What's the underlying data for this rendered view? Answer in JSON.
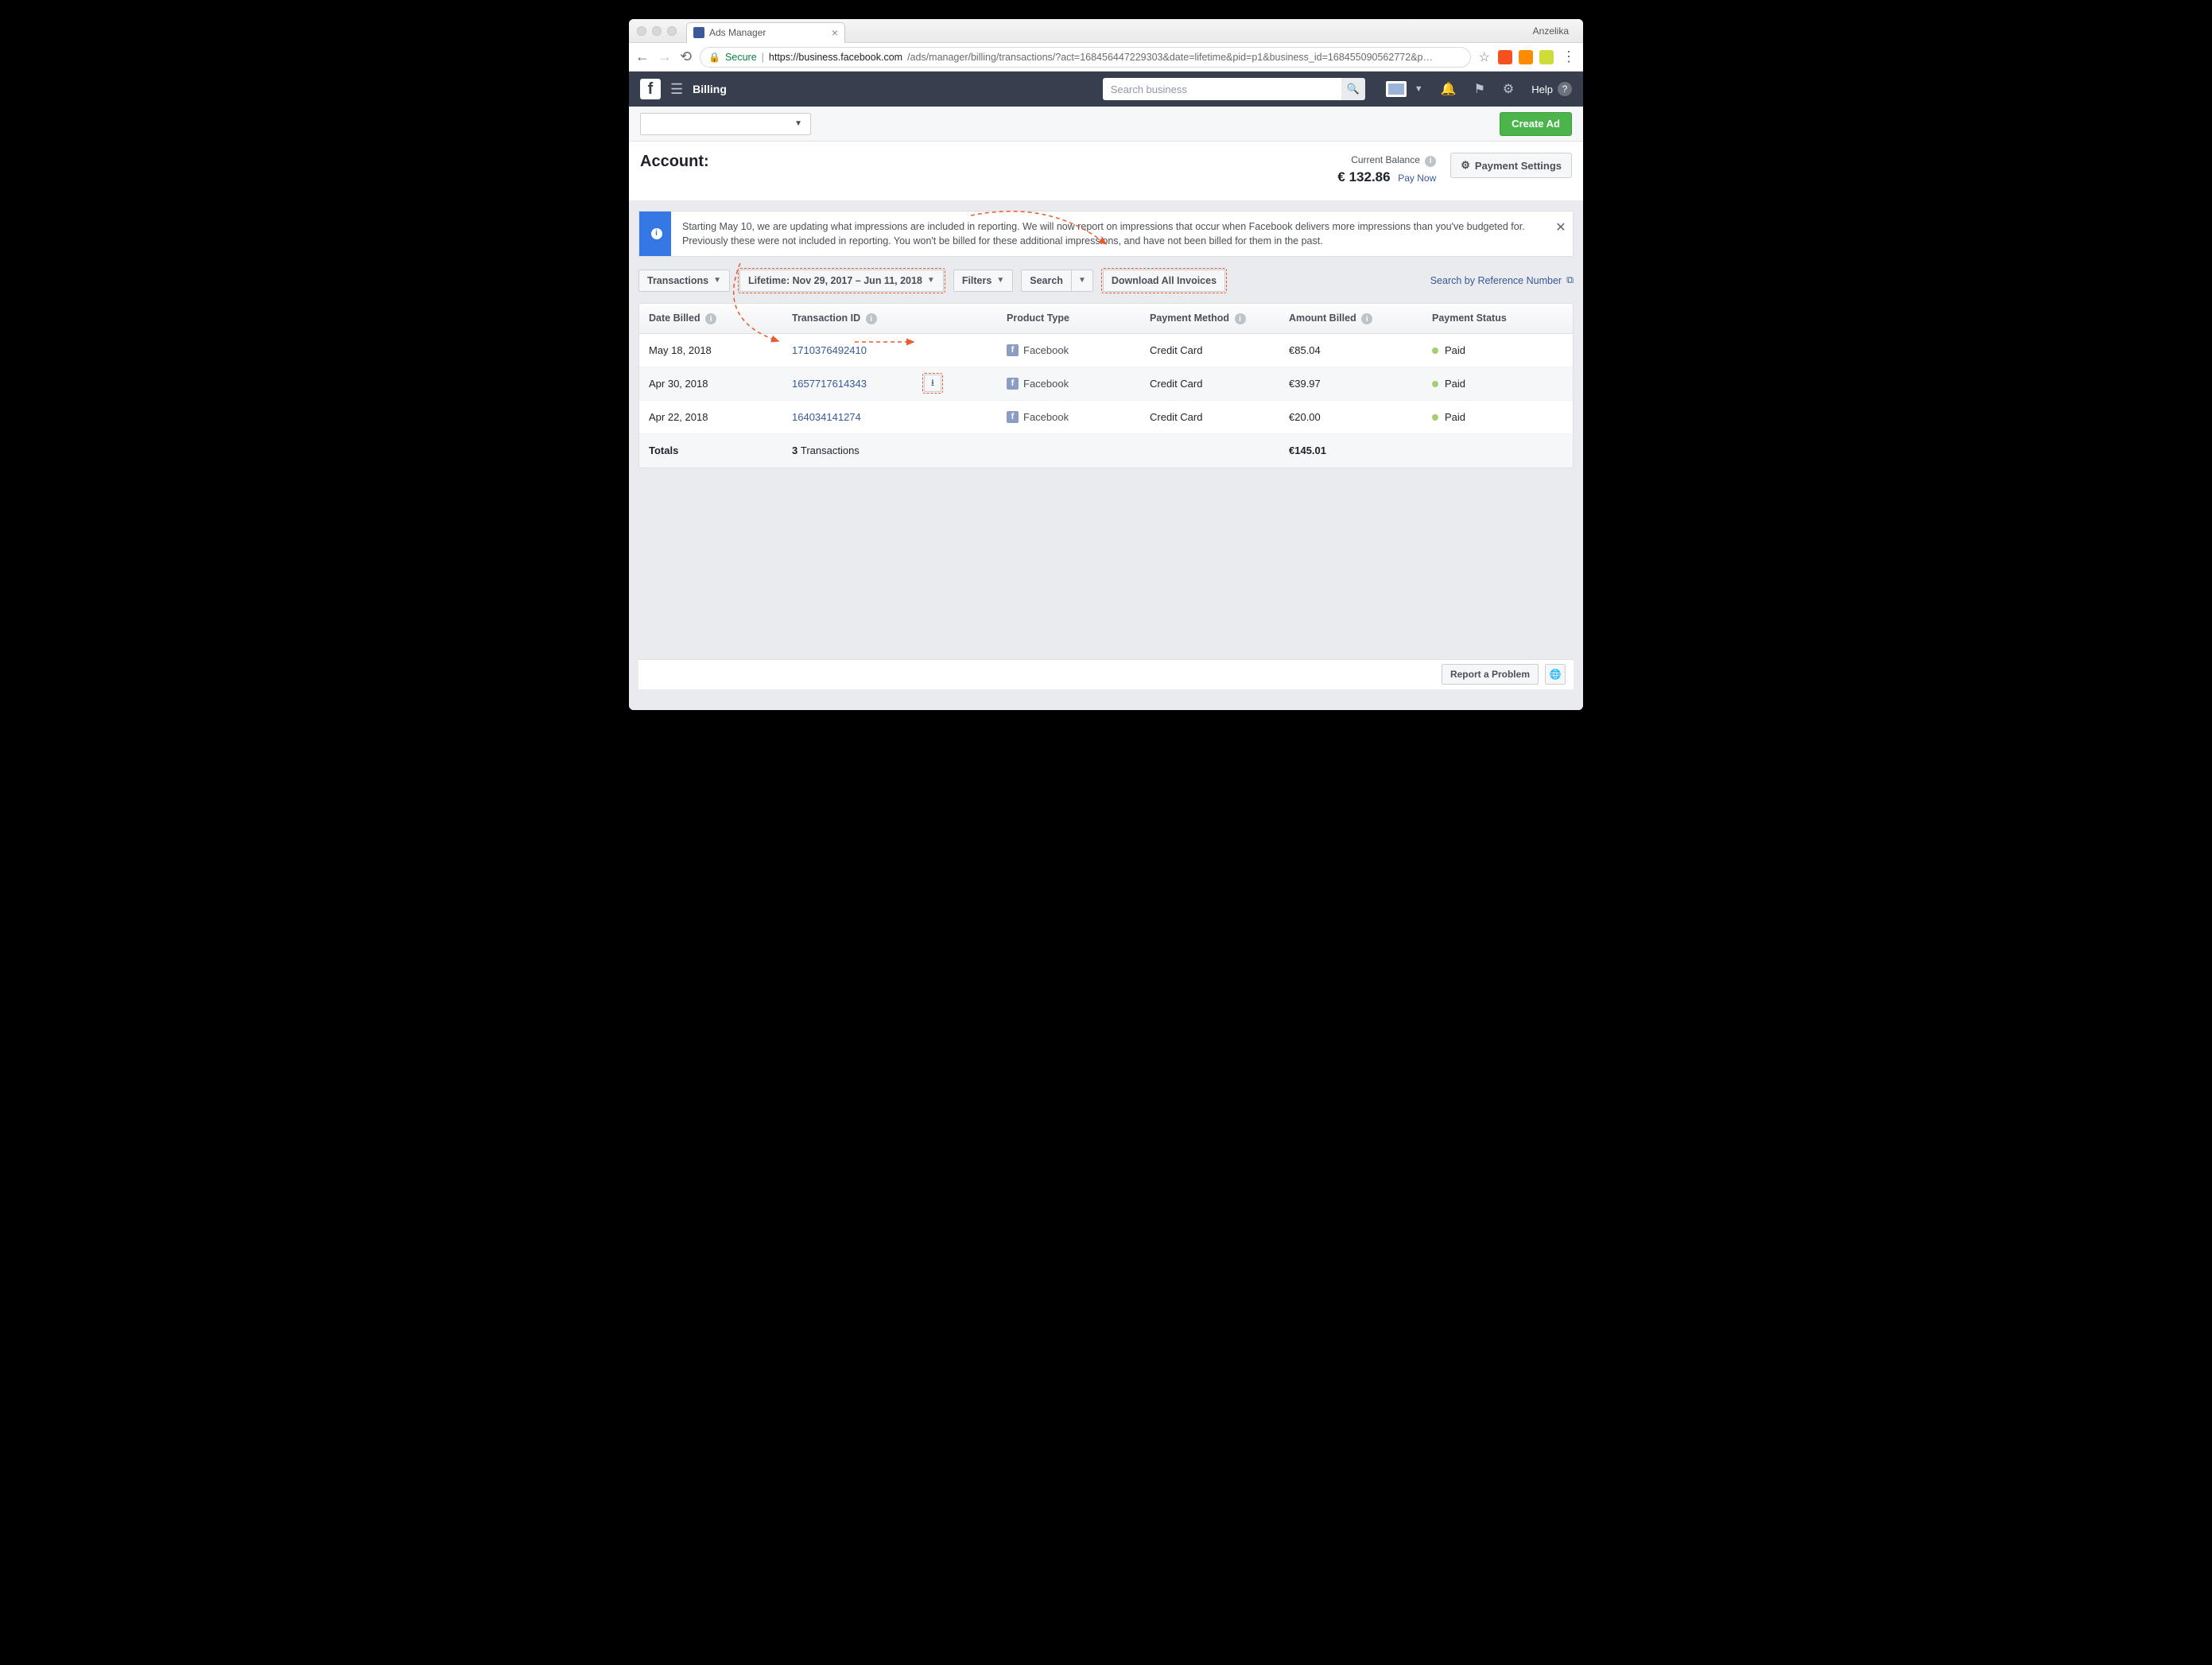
{
  "browser": {
    "tab_title": "Ads Manager",
    "profile": "Anzelika",
    "secure_label": "Secure",
    "url_host": "https://business.facebook.com",
    "url_path": "/ads/manager/billing/transactions/?act=168456447229303&date=lifetime&pid=p1&business_id=168455090562772&p…"
  },
  "topbar": {
    "section": "Billing",
    "search_placeholder": "Search business",
    "help_label": "Help"
  },
  "subbar": {
    "create_ad": "Create Ad"
  },
  "account": {
    "heading": "Account:",
    "balance_label": "Current Balance",
    "balance_amount": "€ 132.86",
    "pay_now": "Pay Now",
    "payment_settings": "Payment Settings"
  },
  "banner": {
    "text": "Starting May 10, we are updating what impressions are included in reporting. We will now report on impressions that occur when Facebook delivers more impressions than you've budgeted for. Previously these were not included in reporting. You won't be billed for these additional impressions, and have not been billed for them in the past."
  },
  "toolbar": {
    "transactions_label": "Transactions",
    "date_range": "Lifetime: Nov 29, 2017 – Jun 11, 2018",
    "filters": "Filters",
    "search": "Search",
    "download_all": "Download All Invoices",
    "ref_search": "Search by Reference Number"
  },
  "columns": {
    "date": "Date Billed",
    "txid": "Transaction ID",
    "product": "Product Type",
    "method": "Payment Method",
    "amount": "Amount Billed",
    "status": "Payment Status"
  },
  "rows": [
    {
      "date": "May 18, 2018",
      "txid": "1710376492410",
      "product": "Facebook",
      "method": "Credit Card",
      "amount": "€85.04",
      "status": "Paid",
      "highlight": false
    },
    {
      "date": "Apr 30, 2018",
      "txid": "1657717614343",
      "product": "Facebook",
      "method": "Credit Card",
      "amount": "€39.97",
      "status": "Paid",
      "highlight": true
    },
    {
      "date": "Apr 22, 2018",
      "txid": "164034141274",
      "product": "Facebook",
      "method": "Credit Card",
      "amount": "€20.00",
      "status": "Paid",
      "highlight": false
    }
  ],
  "totals": {
    "label": "Totals",
    "count_label": "3",
    "count_suffix": "Transactions",
    "amount": "€145.01"
  },
  "footer": {
    "report": "Report a Problem"
  }
}
